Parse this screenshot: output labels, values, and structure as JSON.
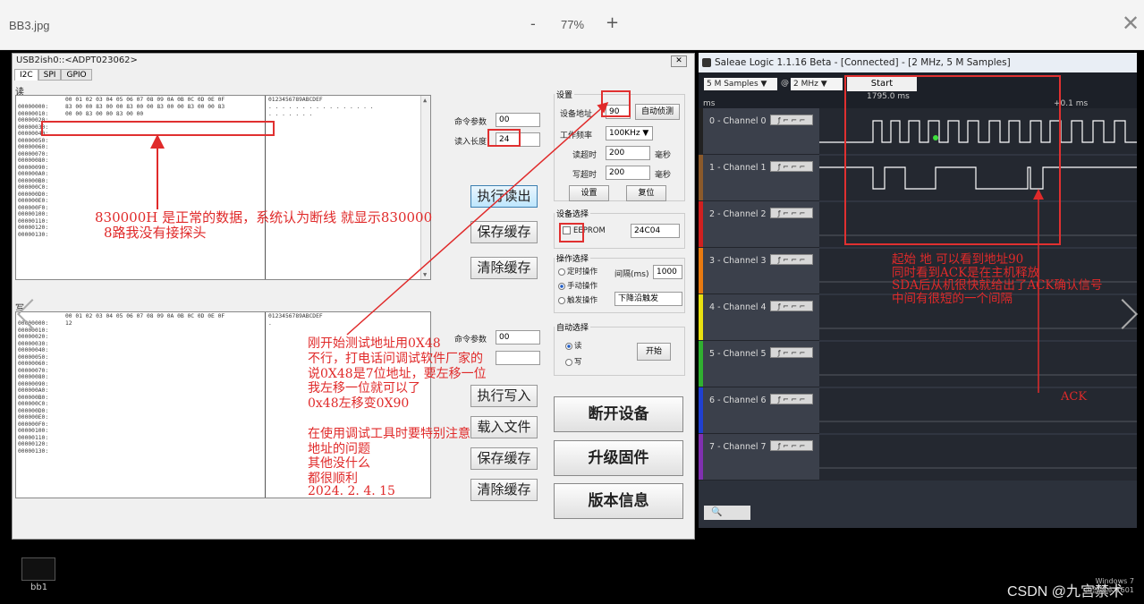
{
  "viewer": {
    "filename": "BB3.jpg",
    "zoom_minus": "-",
    "zoom": "77%",
    "zoom_plus": "+",
    "close": "✕"
  },
  "usb": {
    "title": "USB2ish0::<ADPT023062>",
    "tabs": [
      "I2C",
      "SPI",
      "GPIO"
    ],
    "read_label": "读",
    "write_label": "写",
    "hex_header": "00 01 02 03 04 05 06 07 08 09 0A 0B 0C 0D 0E 0F",
    "ascii_header": "0123456789ABCDEF",
    "read_addresses": [
      "00000000:",
      "00000010:",
      "00000020:",
      "00000030:",
      "00000040:",
      "00000050:",
      "00000060:",
      "00000070:",
      "00000080:",
      "00000090:",
      "000000A0:",
      "000000B0:",
      "000000C0:",
      "000000D0:",
      "000000E0:",
      "000000F0:",
      "00000100:",
      "00000110:",
      "00000120:",
      "00000130:"
    ],
    "read_rows": [
      "83 00 00 83 00 00 83 00 00 83 00 00 83 00 00 83",
      "00 00 83 00 00 83 00 00"
    ],
    "read_ascii": [
      ". . . . . . . . . . . . . . . .",
      ". . . . . . ."
    ],
    "write_addresses": [
      "00000000:",
      "00000010:",
      "00000020:",
      "00000030:",
      "00000040:",
      "00000050:",
      "00000060:",
      "00000070:",
      "00000080:",
      "00000090:",
      "000000A0:",
      "000000B0:",
      "000000C0:",
      "000000D0:",
      "000000E0:",
      "000000F0:",
      "00000100:",
      "00000110:",
      "00000120:",
      "00000130:"
    ],
    "write_rows": [
      "12"
    ],
    "write_ascii": [
      "."
    ],
    "cmd_param_label": "命令参数",
    "cmd_param_value": "00",
    "read_len_label": "读入长度",
    "read_len_value": "24",
    "exec_read": "执行读出",
    "save_cache": "保存缓存",
    "clear_cache": "清除缓存",
    "write_cmd_param_label": "命令参数",
    "write_cmd_param_value": "00",
    "exec_write": "执行写入",
    "load_file": "载入文件",
    "save_cache2": "保存缓存",
    "clear_cache2": "清除缓存",
    "settings": {
      "title": "设置",
      "addr_label": "设备地址",
      "addr_value": "90",
      "auto_detect": "自动侦测",
      "freq_label": "工作频率",
      "freq_value": "100KHz ▼",
      "read_timeout_label": "读超时",
      "read_timeout_value": "200",
      "write_timeout_label": "写超时",
      "write_timeout_value": "200",
      "unit": "毫秒",
      "set_btn": "设置",
      "reset_btn": "复位"
    },
    "device_select": {
      "title": "设备选择",
      "eeprom": "EEPROM",
      "model": "24C04"
    },
    "op_select": {
      "title": "操作选择",
      "timed": "定时操作",
      "interval_label": "间隔(ms)",
      "interval": "1000",
      "manual": "手动操作",
      "trigger": "触发操作",
      "trigger_mode": "下降沿触发"
    },
    "auto_select": {
      "title": "自动选择",
      "read": "读",
      "write": "写",
      "start": "开始"
    },
    "disconnect": "断开设备",
    "upgrade": "升级固件",
    "version": "版本信息"
  },
  "annotations": {
    "note1_line1": "830000H 是正常的数据，系统认为断线 就显示830000",
    "note1_line2": "8路我没有接探头",
    "note2": [
      "刚开始测试地址用0X48",
      "不行，打电话问调试软件厂家的",
      "说0X48是7位地址，要左移一位",
      "我左移一位就可以了",
      "0x48左移变0X90",
      "",
      "在使用调试工具时要特别注意",
      "地址的问题",
      "其他没什么",
      "都很顺利",
      "2024. 2. 4. 15"
    ],
    "note3": [
      "起始 地 可以看到地址90",
      "同时看到ACK是在主机释放",
      "SDA后从机很快就给出了ACK确认信号",
      "中间有很短的一个间隔"
    ],
    "ack": "ACK"
  },
  "saleae": {
    "title": "Saleae Logic 1.1.16 Beta - [Connected] - [2 MHz, 5 M Samples]",
    "samples": "5 M Samples ▼",
    "rate": "2 MHz ▼",
    "at": "@",
    "start": "Start",
    "time_start": "1795.0 ms",
    "ms_label": "ms",
    "time_offset": "+0.1 ms",
    "channels": [
      "0 - Channel 0",
      "1 - Channel 1",
      "2 - Channel 2",
      "3 - Channel 3",
      "4 - Channel 4",
      "5 - Channel 5",
      "6 - Channel 6",
      "7 - Channel 7"
    ],
    "channel_colors": [
      "#222222",
      "#8b5a2b",
      "#d02020",
      "#e87a10",
      "#e8e010",
      "#30b030",
      "#2040d0",
      "#8030b0"
    ],
    "chan_btn": "ƒ ⌐ ⌐ ⌐",
    "search_icon": "magnifier"
  },
  "taskbar": {
    "thumb_label": "bb1",
    "watermark": "CSDN @九宫禁术",
    "win_line1": "Windows 7",
    "win_line2": "内部版本 7601"
  }
}
